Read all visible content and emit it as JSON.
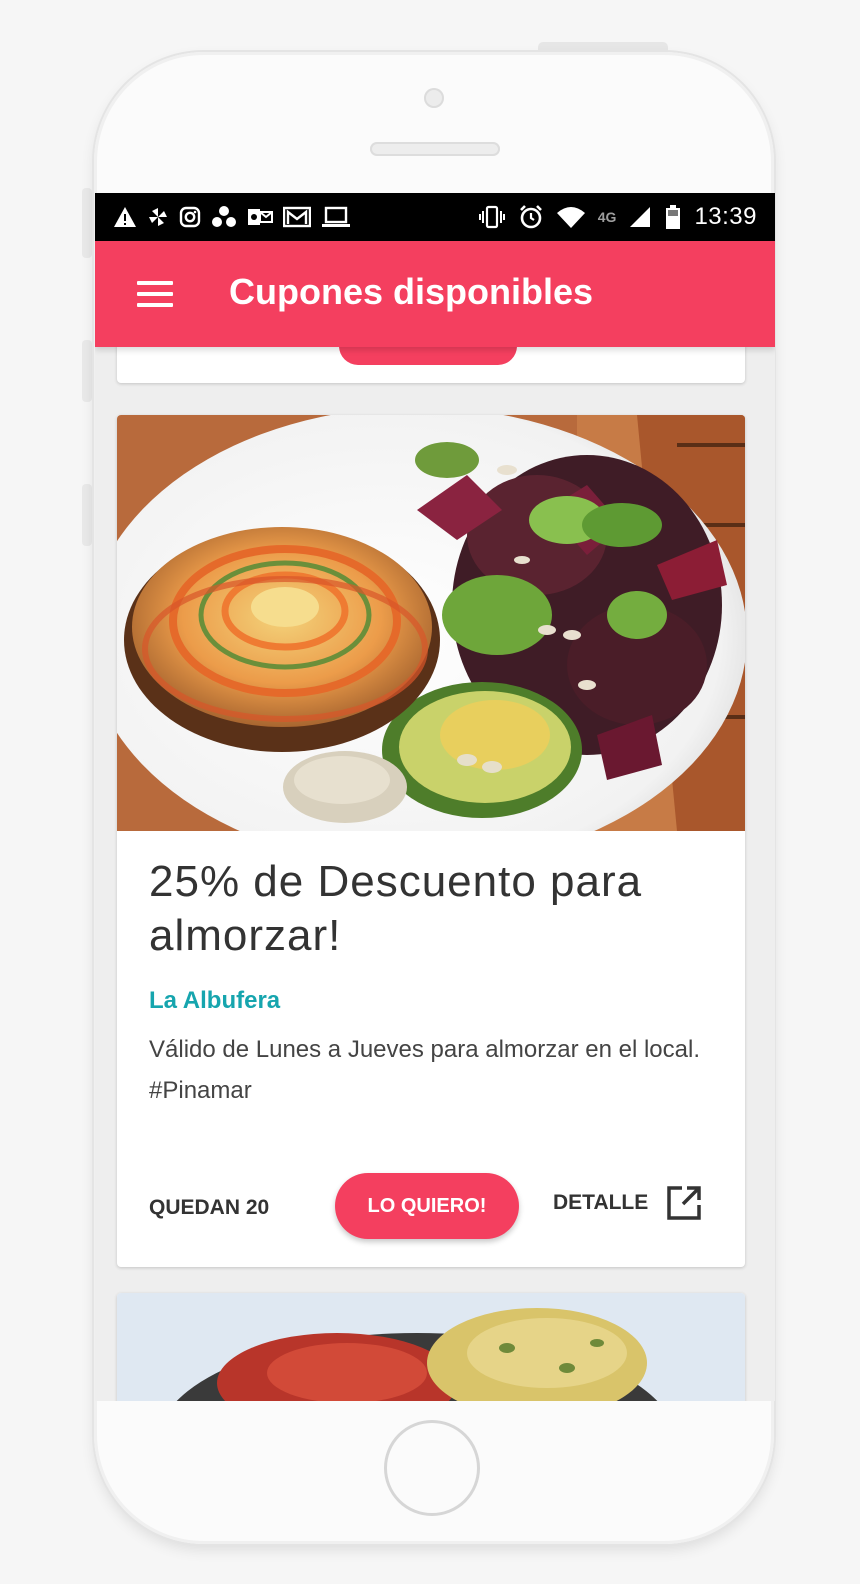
{
  "status_bar": {
    "left_icons": [
      "warning-icon",
      "pinwheel-icon",
      "instagram-icon",
      "cluster-icon",
      "outlook-icon",
      "gmail-icon",
      "laptop-icon"
    ],
    "right_icons": [
      "vibrate-icon",
      "alarm-icon",
      "wifi-icon",
      "cellular-signal-icon",
      "battery-icon"
    ],
    "network": "4G",
    "time": "13:39"
  },
  "app_bar": {
    "title": "Cupones disponibles",
    "color": "#f43f5f"
  },
  "coupon": {
    "image_alt": "Tarta de vegetales con ensalada y palta",
    "title": "25% de Descuento para almorzar!",
    "venue": "La Albufera",
    "description_line1": "Válido de Lunes a Jueves para almorzar en el local.",
    "hashtag": "#Pinamar",
    "remaining": "QUEDAN 20",
    "cta_label": "LO QUIERO!",
    "detail_label": "DETALLE"
  },
  "colors": {
    "accent": "#f43f5f",
    "venue": "#16a5ae"
  }
}
